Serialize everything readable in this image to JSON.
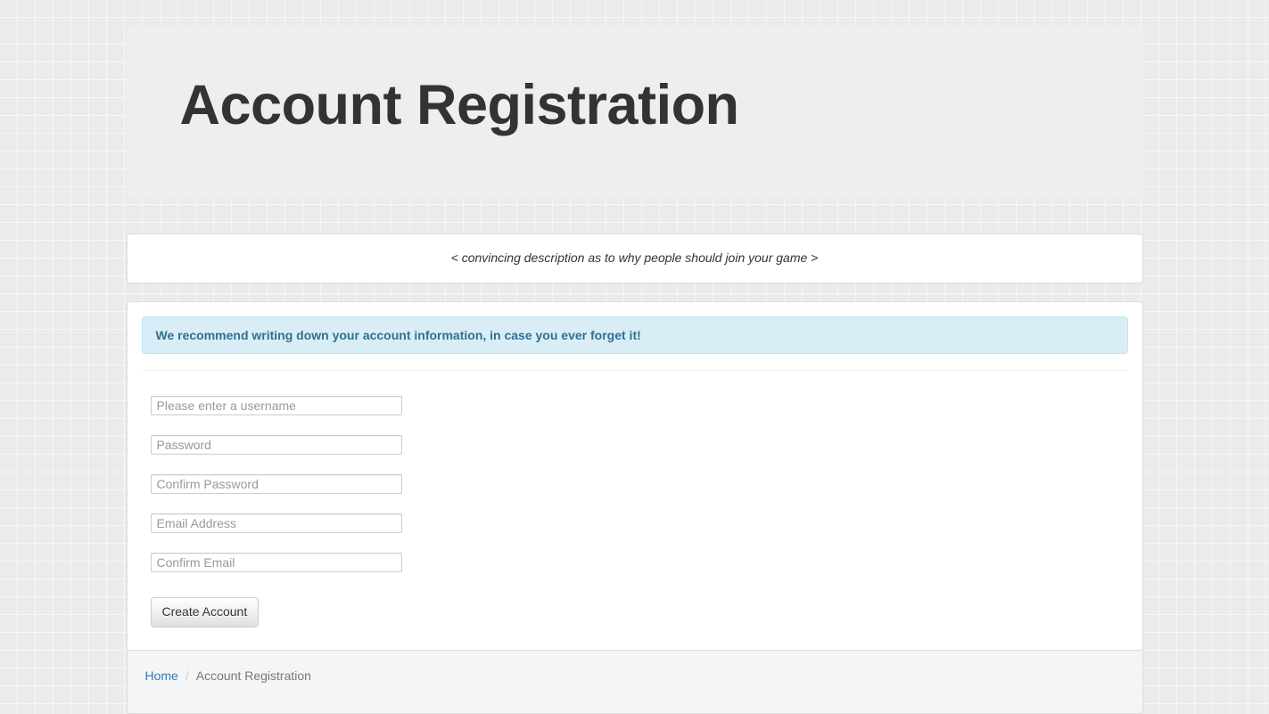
{
  "header": {
    "title": "Account Registration"
  },
  "description_panel": {
    "text": "< convincing description as to why people should join your game >"
  },
  "info_alert": {
    "text": "We recommend writing down your account information, in case you ever forget it!"
  },
  "form": {
    "username": {
      "placeholder": "Please enter a username",
      "value": ""
    },
    "password": {
      "placeholder": "Password",
      "value": ""
    },
    "confirm_password": {
      "placeholder": "Confirm Password",
      "value": ""
    },
    "email": {
      "placeholder": "Email Address",
      "value": ""
    },
    "confirm_email": {
      "placeholder": "Confirm Email",
      "value": ""
    },
    "submit_label": "Create Account"
  },
  "breadcrumb": {
    "home": "Home",
    "separator": "/",
    "current": "Account Registration"
  }
}
